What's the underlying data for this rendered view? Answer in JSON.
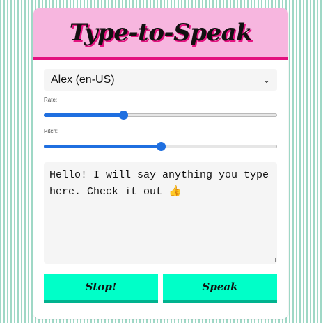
{
  "app": {
    "title": "Type-to-Speak"
  },
  "voice": {
    "selected": "Alex (en-US)"
  },
  "rate": {
    "label": "Rate:",
    "value": 0.34
  },
  "pitch": {
    "label": "Pitch:",
    "value": 0.5
  },
  "message": {
    "text": "Hello! I will say anything you type here. Check it out 👍"
  },
  "buttons": {
    "stop_label": "Stop!",
    "speak_label": "Speak"
  },
  "colors": {
    "header_bg": "#f7b6df",
    "accent_pink": "#e3117f",
    "button_bg": "#00ffc8",
    "slider_blue": "#1f6fe0",
    "stripe": "#9fd8c6"
  }
}
